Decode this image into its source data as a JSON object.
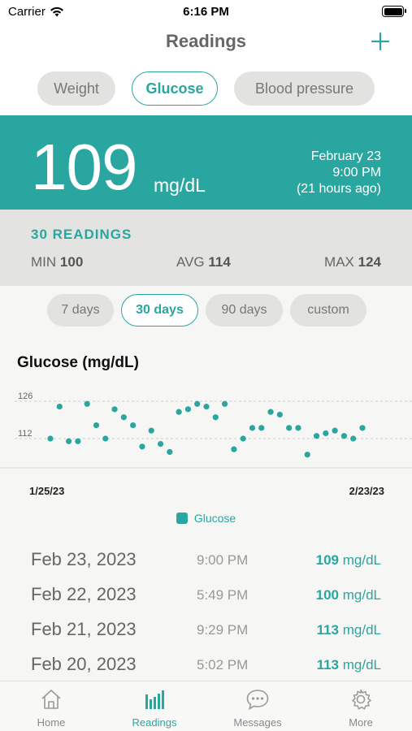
{
  "status_bar": {
    "carrier": "Carrier",
    "time": "6:16 PM"
  },
  "nav": {
    "title": "Readings",
    "add_icon": "plus-icon"
  },
  "type_tabs": [
    {
      "label": "Weight",
      "active": false
    },
    {
      "label": "Glucose",
      "active": true
    },
    {
      "label": "Blood pressure",
      "active": false
    }
  ],
  "latest": {
    "value": "109",
    "unit": "mg/dL",
    "date": "February 23",
    "time": "9:00 PM",
    "relative": "(21 hours ago)"
  },
  "summary": {
    "count_label": "30 READINGS",
    "min_label": "MIN",
    "min_value": "100",
    "avg_label": "AVG",
    "avg_value": "114",
    "max_label": "MAX",
    "max_value": "124"
  },
  "range_tabs": [
    {
      "label": "7 days",
      "active": false
    },
    {
      "label": "30 days",
      "active": true
    },
    {
      "label": "90 days",
      "active": false
    },
    {
      "label": "custom",
      "active": false
    }
  ],
  "chart_data": {
    "type": "scatter",
    "title": "Glucose (mg/dL)",
    "x_start_label": "1/25/23",
    "x_end_label": "2/23/23",
    "y_ticks": [
      126,
      112
    ],
    "series": [
      {
        "name": "Glucose",
        "color": "#2aa6a0",
        "x": [
          1,
          2,
          3,
          4,
          5,
          6,
          7,
          8,
          9,
          10,
          11,
          12,
          13,
          14,
          15,
          16,
          17,
          18,
          19,
          20,
          21,
          22,
          23,
          24,
          25,
          26,
          27,
          28,
          29,
          30,
          31,
          32,
          33,
          34,
          35
        ],
        "y": [
          112,
          124,
          111,
          111,
          125,
          117,
          112,
          123,
          120,
          117,
          109,
          115,
          110,
          107,
          122,
          123,
          125,
          124,
          120,
          125,
          108,
          112,
          116,
          116,
          122,
          121,
          116,
          116,
          106,
          113,
          114,
          115,
          113,
          112,
          116
        ]
      }
    ],
    "legend_position": "bottom"
  },
  "readings": [
    {
      "date": "Feb 23, 2023",
      "time": "9:00 PM",
      "value": "109",
      "unit": "mg/dL"
    },
    {
      "date": "Feb 22, 2023",
      "time": "5:49 PM",
      "value": "100",
      "unit": "mg/dL"
    },
    {
      "date": "Feb 21, 2023",
      "time": "9:29 PM",
      "value": "113",
      "unit": "mg/dL"
    },
    {
      "date": "Feb 20, 2023",
      "time": "5:02 PM",
      "value": "113",
      "unit": "mg/dL"
    }
  ],
  "tab_bar": [
    {
      "label": "Home",
      "icon": "house-icon",
      "active": false
    },
    {
      "label": "Readings",
      "icon": "bar-chart-icon",
      "active": true
    },
    {
      "label": "Messages",
      "icon": "chat-bubble-icon",
      "active": false
    },
    {
      "label": "More",
      "icon": "gear-icon",
      "active": false
    }
  ],
  "colors": {
    "accent": "#2aa6a0",
    "summary_bg": "#e3e3e1",
    "pill_bg": "#e2e2e0"
  }
}
